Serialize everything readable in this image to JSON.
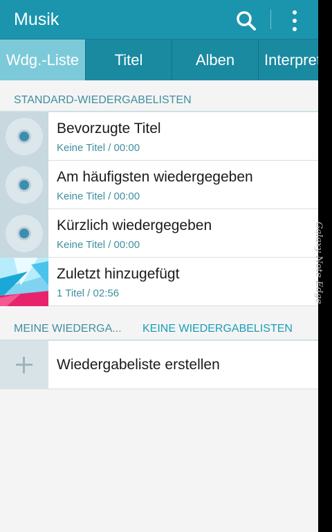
{
  "app": {
    "title": "Musik"
  },
  "toolbar": {
    "search_icon": "search-icon",
    "more_icon": "more-vert-icon"
  },
  "tabs": [
    {
      "label": "Wdg.-Liste"
    },
    {
      "label": "Titel"
    },
    {
      "label": "Alben"
    },
    {
      "label": "Interpreten"
    }
  ],
  "standard_section": {
    "header": "STANDARD-WIEDERGABELISTEN",
    "items": [
      {
        "title": "Bevorzugte Titel",
        "subtitle": "Keine Titel / 00:00",
        "icon": "disc-icon"
      },
      {
        "title": "Am häufigsten wiedergegeben",
        "subtitle": "Keine Titel / 00:00",
        "icon": "disc-icon"
      },
      {
        "title": "Kürzlich wiedergegeben",
        "subtitle": "Keine Titel / 00:00",
        "icon": "disc-icon"
      },
      {
        "title": "Zuletzt hinzugefügt",
        "subtitle": "1 Titel / 02:56",
        "icon": "album-art"
      }
    ]
  },
  "my_section": {
    "header": "MEINE WIEDERGA...",
    "status": "KEINE WIEDERGABELISTEN",
    "create_label": "Wiedergabeliste erstellen"
  },
  "device": {
    "edge_label": "Galaxy Note Edge"
  },
  "colors": {
    "appbar": "#1b95ad",
    "tabs": "#1a8aa1",
    "active_tab": "#7ccad9",
    "accent_text": "#3f8e9e"
  }
}
